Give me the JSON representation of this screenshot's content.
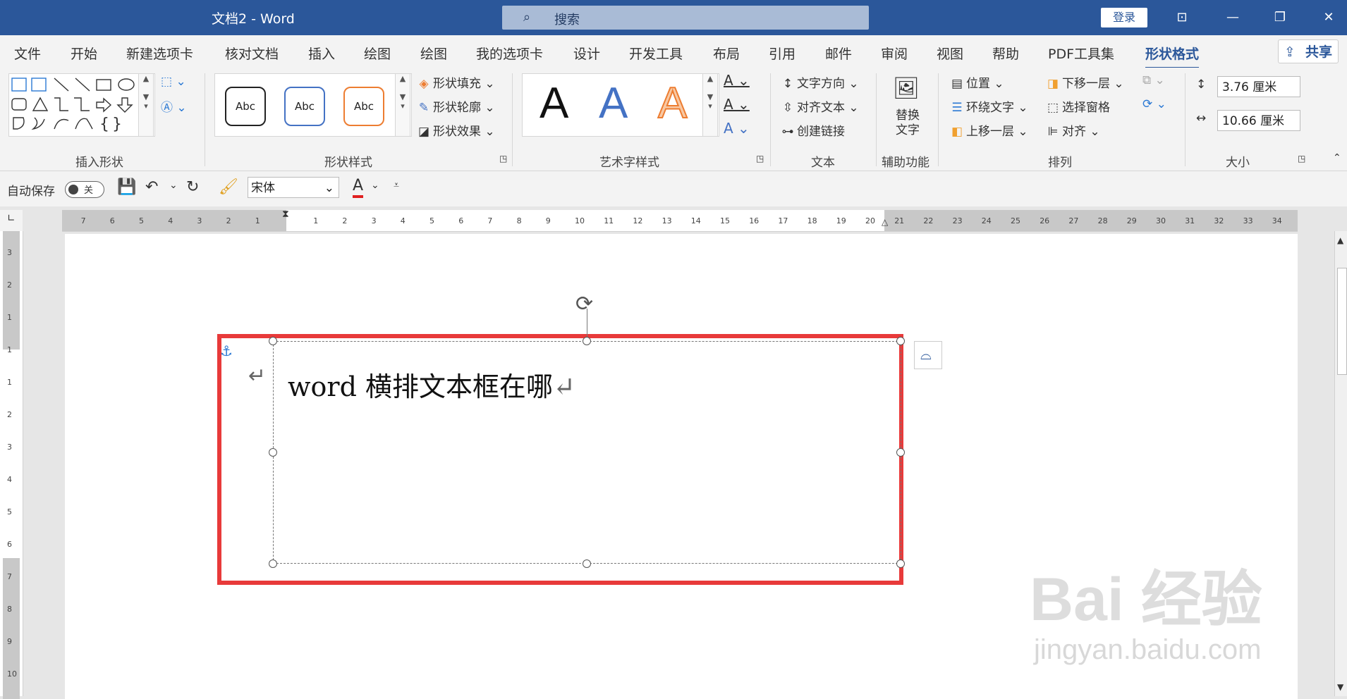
{
  "window": {
    "title": "文档2  -  Word",
    "search_placeholder": "搜索",
    "login": "登录"
  },
  "tabs": [
    "文件",
    "开始",
    "新建选项卡",
    "核对文档",
    "插入",
    "绘图",
    "绘图",
    "我的选项卡",
    "设计",
    "开发工具",
    "布局",
    "引用",
    "邮件",
    "审阅",
    "视图",
    "帮助",
    "PDF工具集",
    "形状格式"
  ],
  "active_tab": "形状格式",
  "share": "共享",
  "ribbon": {
    "insert_shapes": {
      "label": "插入形状"
    },
    "shape_styles": {
      "label": "形状样式",
      "abc": [
        "Abc",
        "Abc",
        "Abc"
      ],
      "fill": "形状填充",
      "outline": "形状轮廓",
      "effects": "形状效果"
    },
    "wordart_styles": {
      "label": "艺术字样式",
      "letters": [
        "A",
        "A",
        "A"
      ]
    },
    "text": {
      "label": "文本",
      "direction": "文字方向",
      "align": "对齐文本",
      "link": "创建链接"
    },
    "accessibility": {
      "label": "辅助功能",
      "alt_text": "替换\n文字",
      "alt_line1": "替换",
      "alt_line2": "文字"
    },
    "arrange": {
      "label": "排列",
      "position": "位置",
      "wrap": "环绕文字",
      "forward": "上移一层",
      "backward": "下移一层",
      "pane": "选择窗格",
      "align": "对齐"
    },
    "size": {
      "label": "大小",
      "height": "3.76 厘米",
      "width": "10.66 厘米"
    }
  },
  "qat": {
    "autosave": "自动保存",
    "autosave_state": "关",
    "font": "宋体"
  },
  "ruler": {
    "h_left": [
      "7",
      "6",
      "5",
      "4",
      "3",
      "2",
      "1"
    ],
    "h_right": [
      "1",
      "2",
      "3",
      "4",
      "5",
      "6",
      "7",
      "8",
      "9",
      "10",
      "11",
      "12",
      "13",
      "14",
      "15",
      "16",
      "17",
      "18",
      "19",
      "20",
      "21",
      "22",
      "23",
      "24",
      "25",
      "26",
      "27",
      "28",
      "29",
      "30",
      "31",
      "32",
      "33",
      "34"
    ],
    "v": [
      "3",
      "2",
      "1",
      "1",
      "1",
      "2",
      "3",
      "4",
      "5",
      "6",
      "7",
      "8",
      "9",
      "10"
    ]
  },
  "document": {
    "textbox_text": "word 横排文本框在哪",
    "para_mark": "↵"
  },
  "watermark": {
    "line1": "Bai  经验",
    "line2": "jingyan.baidu.com"
  },
  "colors": {
    "title_bar": "#2b579a",
    "highlight": "#e83a3a"
  }
}
